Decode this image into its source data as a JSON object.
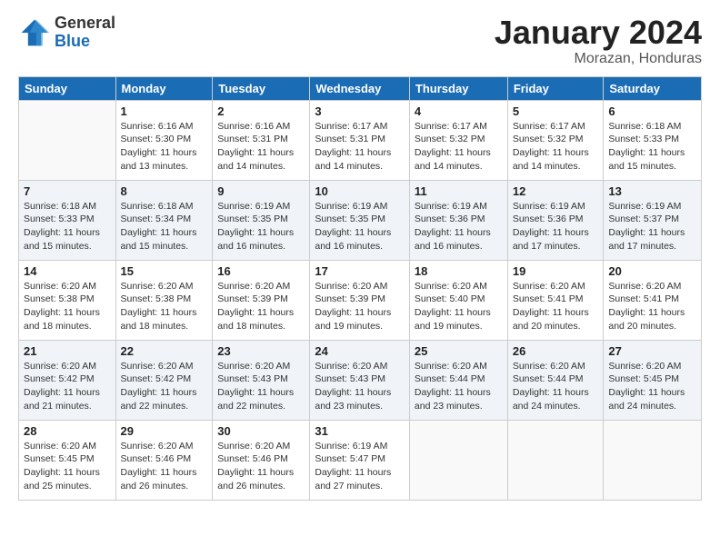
{
  "logo": {
    "general": "General",
    "blue": "Blue"
  },
  "header": {
    "month": "January 2024",
    "location": "Morazan, Honduras"
  },
  "weekdays": [
    "Sunday",
    "Monday",
    "Tuesday",
    "Wednesday",
    "Thursday",
    "Friday",
    "Saturday"
  ],
  "weeks": [
    [
      {
        "day": "",
        "sunrise": "",
        "sunset": "",
        "daylight": ""
      },
      {
        "day": "1",
        "sunrise": "Sunrise: 6:16 AM",
        "sunset": "Sunset: 5:30 PM",
        "daylight": "Daylight: 11 hours and 13 minutes."
      },
      {
        "day": "2",
        "sunrise": "Sunrise: 6:16 AM",
        "sunset": "Sunset: 5:31 PM",
        "daylight": "Daylight: 11 hours and 14 minutes."
      },
      {
        "day": "3",
        "sunrise": "Sunrise: 6:17 AM",
        "sunset": "Sunset: 5:31 PM",
        "daylight": "Daylight: 11 hours and 14 minutes."
      },
      {
        "day": "4",
        "sunrise": "Sunrise: 6:17 AM",
        "sunset": "Sunset: 5:32 PM",
        "daylight": "Daylight: 11 hours and 14 minutes."
      },
      {
        "day": "5",
        "sunrise": "Sunrise: 6:17 AM",
        "sunset": "Sunset: 5:32 PM",
        "daylight": "Daylight: 11 hours and 14 minutes."
      },
      {
        "day": "6",
        "sunrise": "Sunrise: 6:18 AM",
        "sunset": "Sunset: 5:33 PM",
        "daylight": "Daylight: 11 hours and 15 minutes."
      }
    ],
    [
      {
        "day": "7",
        "sunrise": "Sunrise: 6:18 AM",
        "sunset": "Sunset: 5:33 PM",
        "daylight": "Daylight: 11 hours and 15 minutes."
      },
      {
        "day": "8",
        "sunrise": "Sunrise: 6:18 AM",
        "sunset": "Sunset: 5:34 PM",
        "daylight": "Daylight: 11 hours and 15 minutes."
      },
      {
        "day": "9",
        "sunrise": "Sunrise: 6:19 AM",
        "sunset": "Sunset: 5:35 PM",
        "daylight": "Daylight: 11 hours and 16 minutes."
      },
      {
        "day": "10",
        "sunrise": "Sunrise: 6:19 AM",
        "sunset": "Sunset: 5:35 PM",
        "daylight": "Daylight: 11 hours and 16 minutes."
      },
      {
        "day": "11",
        "sunrise": "Sunrise: 6:19 AM",
        "sunset": "Sunset: 5:36 PM",
        "daylight": "Daylight: 11 hours and 16 minutes."
      },
      {
        "day": "12",
        "sunrise": "Sunrise: 6:19 AM",
        "sunset": "Sunset: 5:36 PM",
        "daylight": "Daylight: 11 hours and 17 minutes."
      },
      {
        "day": "13",
        "sunrise": "Sunrise: 6:19 AM",
        "sunset": "Sunset: 5:37 PM",
        "daylight": "Daylight: 11 hours and 17 minutes."
      }
    ],
    [
      {
        "day": "14",
        "sunrise": "Sunrise: 6:20 AM",
        "sunset": "Sunset: 5:38 PM",
        "daylight": "Daylight: 11 hours and 18 minutes."
      },
      {
        "day": "15",
        "sunrise": "Sunrise: 6:20 AM",
        "sunset": "Sunset: 5:38 PM",
        "daylight": "Daylight: 11 hours and 18 minutes."
      },
      {
        "day": "16",
        "sunrise": "Sunrise: 6:20 AM",
        "sunset": "Sunset: 5:39 PM",
        "daylight": "Daylight: 11 hours and 18 minutes."
      },
      {
        "day": "17",
        "sunrise": "Sunrise: 6:20 AM",
        "sunset": "Sunset: 5:39 PM",
        "daylight": "Daylight: 11 hours and 19 minutes."
      },
      {
        "day": "18",
        "sunrise": "Sunrise: 6:20 AM",
        "sunset": "Sunset: 5:40 PM",
        "daylight": "Daylight: 11 hours and 19 minutes."
      },
      {
        "day": "19",
        "sunrise": "Sunrise: 6:20 AM",
        "sunset": "Sunset: 5:41 PM",
        "daylight": "Daylight: 11 hours and 20 minutes."
      },
      {
        "day": "20",
        "sunrise": "Sunrise: 6:20 AM",
        "sunset": "Sunset: 5:41 PM",
        "daylight": "Daylight: 11 hours and 20 minutes."
      }
    ],
    [
      {
        "day": "21",
        "sunrise": "Sunrise: 6:20 AM",
        "sunset": "Sunset: 5:42 PM",
        "daylight": "Daylight: 11 hours and 21 minutes."
      },
      {
        "day": "22",
        "sunrise": "Sunrise: 6:20 AM",
        "sunset": "Sunset: 5:42 PM",
        "daylight": "Daylight: 11 hours and 22 minutes."
      },
      {
        "day": "23",
        "sunrise": "Sunrise: 6:20 AM",
        "sunset": "Sunset: 5:43 PM",
        "daylight": "Daylight: 11 hours and 22 minutes."
      },
      {
        "day": "24",
        "sunrise": "Sunrise: 6:20 AM",
        "sunset": "Sunset: 5:43 PM",
        "daylight": "Daylight: 11 hours and 23 minutes."
      },
      {
        "day": "25",
        "sunrise": "Sunrise: 6:20 AM",
        "sunset": "Sunset: 5:44 PM",
        "daylight": "Daylight: 11 hours and 23 minutes."
      },
      {
        "day": "26",
        "sunrise": "Sunrise: 6:20 AM",
        "sunset": "Sunset: 5:44 PM",
        "daylight": "Daylight: 11 hours and 24 minutes."
      },
      {
        "day": "27",
        "sunrise": "Sunrise: 6:20 AM",
        "sunset": "Sunset: 5:45 PM",
        "daylight": "Daylight: 11 hours and 24 minutes."
      }
    ],
    [
      {
        "day": "28",
        "sunrise": "Sunrise: 6:20 AM",
        "sunset": "Sunset: 5:45 PM",
        "daylight": "Daylight: 11 hours and 25 minutes."
      },
      {
        "day": "29",
        "sunrise": "Sunrise: 6:20 AM",
        "sunset": "Sunset: 5:46 PM",
        "daylight": "Daylight: 11 hours and 26 minutes."
      },
      {
        "day": "30",
        "sunrise": "Sunrise: 6:20 AM",
        "sunset": "Sunset: 5:46 PM",
        "daylight": "Daylight: 11 hours and 26 minutes."
      },
      {
        "day": "31",
        "sunrise": "Sunrise: 6:19 AM",
        "sunset": "Sunset: 5:47 PM",
        "daylight": "Daylight: 11 hours and 27 minutes."
      },
      {
        "day": "",
        "sunrise": "",
        "sunset": "",
        "daylight": ""
      },
      {
        "day": "",
        "sunrise": "",
        "sunset": "",
        "daylight": ""
      },
      {
        "day": "",
        "sunrise": "",
        "sunset": "",
        "daylight": ""
      }
    ]
  ]
}
